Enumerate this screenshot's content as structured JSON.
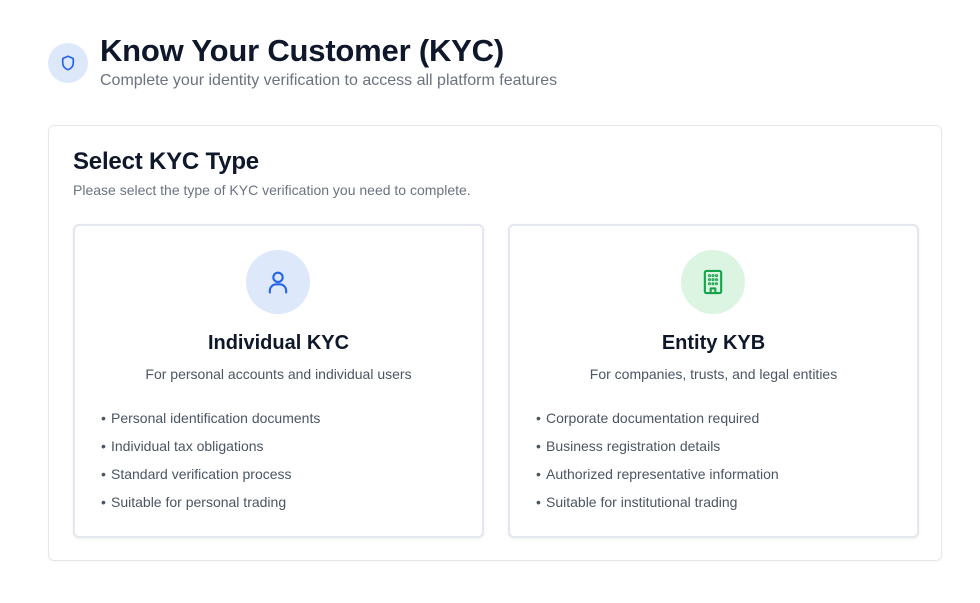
{
  "header": {
    "title": "Know Your Customer (KYC)",
    "subtitle": "Complete your identity verification to access all platform features",
    "icon": "shield-icon"
  },
  "panel": {
    "title": "Select KYC Type",
    "subtitle": "Please select the type of KYC verification you need to complete."
  },
  "cards": [
    {
      "title": "Individual KYC",
      "description": "For personal accounts and individual users",
      "icon": "user-icon",
      "icon_color": "#2563eb",
      "icon_bg": "#dde8fb",
      "features": [
        "Personal identification documents",
        "Individual tax obligations",
        "Standard verification process",
        "Suitable for personal trading"
      ]
    },
    {
      "title": "Entity KYB",
      "description": "For companies, trusts, and legal entities",
      "icon": "building-icon",
      "icon_color": "#16a34a",
      "icon_bg": "#dcf5e3",
      "features": [
        "Corporate documentation required",
        "Business registration details",
        "Authorized representative information",
        "Suitable for institutional trading"
      ]
    }
  ],
  "colors": {
    "accent_blue": "#2563eb",
    "accent_green": "#16a34a",
    "border": "#e5e7eb"
  }
}
